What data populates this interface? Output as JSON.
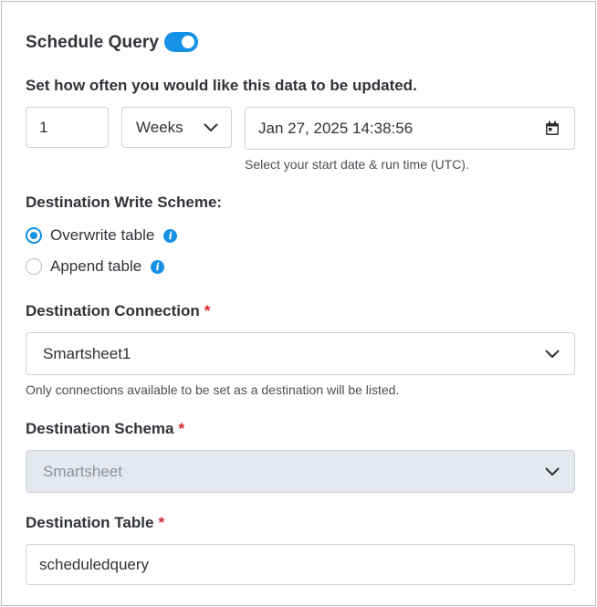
{
  "header": {
    "title": "Schedule Query",
    "toggle_on": true
  },
  "schedule": {
    "prompt": "Set how often you would like this data to be updated.",
    "interval_value": "1",
    "interval_unit": "Weeks",
    "start_datetime": "Jan 27, 2025 14:38:56",
    "start_hint": "Select your start date & run time (UTC)."
  },
  "write_scheme": {
    "label": "Destination Write Scheme:",
    "options": [
      {
        "label": "Overwrite table",
        "selected": true
      },
      {
        "label": "Append table",
        "selected": false
      }
    ],
    "info_glyph": "i"
  },
  "destination_connection": {
    "label": "Destination Connection",
    "required_mark": "*",
    "value": "Smartsheet1",
    "hint": "Only connections available to be set as a destination will be listed."
  },
  "destination_schema": {
    "label": "Destination Schema",
    "required_mark": "*",
    "value": "Smartsheet",
    "disabled": true
  },
  "destination_table": {
    "label": "Destination Table",
    "required_mark": "*",
    "value": "scheduledquery"
  },
  "colors": {
    "accent": "#1592e6",
    "required": "#d9232e",
    "disabled_bg": "#e5e8ee"
  },
  "icons": {
    "calendar": "calendar-icon",
    "chevron": "chevron-down-icon",
    "info": "info-icon"
  }
}
